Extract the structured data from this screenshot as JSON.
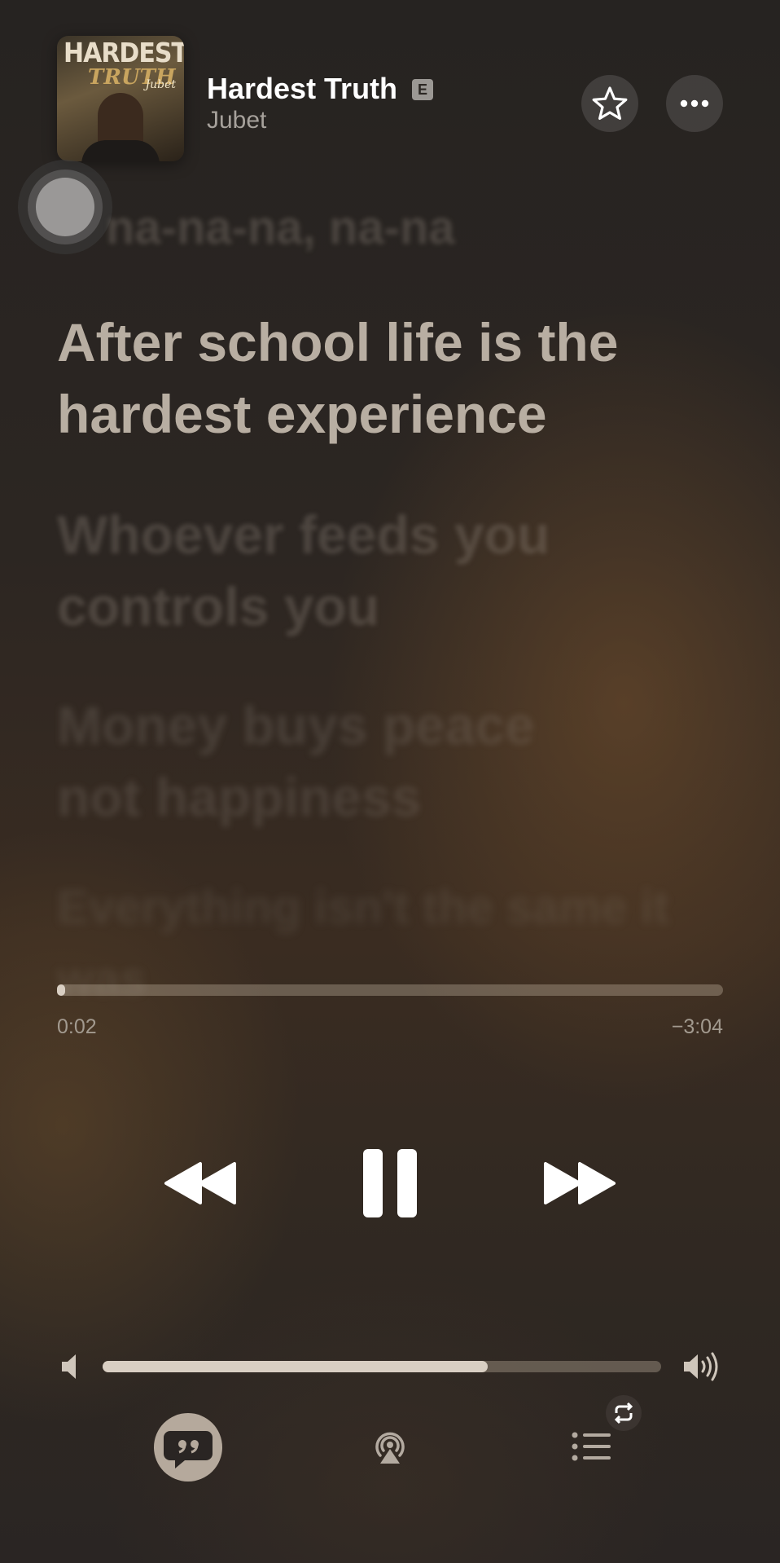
{
  "now_playing": {
    "title": "Hardest Truth",
    "explicit_badge": "E",
    "artist": "Jubet",
    "artwork": {
      "title_line1": "HARDEST",
      "title_line2": "TRUTH",
      "signature": "Jubet"
    }
  },
  "lyrics": {
    "previous_line": "na-na-na, na-na",
    "current_line": "After school life is the hardest experience",
    "next_lines": [
      "Whoever feeds you controls you",
      "Money buys peace not happiness",
      "Everything isn't the same it was"
    ]
  },
  "playback": {
    "elapsed": "0:02",
    "remaining": "−3:04",
    "progress_fraction": 0.011
  },
  "volume": {
    "level_fraction": 0.69
  },
  "icons": {
    "favorite": "star-icon",
    "more": "ellipsis-icon",
    "previous": "backward-icon",
    "pause": "pause-icon",
    "next": "forward-icon",
    "volume_low": "speaker-low-icon",
    "volume_high": "speaker-high-icon",
    "lyrics": "quote-bubble-icon",
    "airplay": "airplay-icon",
    "queue": "list-icon",
    "repeat": "repeat-icon"
  },
  "colors": {
    "accent": "#d9cfc3",
    "text_primary": "#ffffff",
    "text_secondary": "#a6a19b"
  }
}
